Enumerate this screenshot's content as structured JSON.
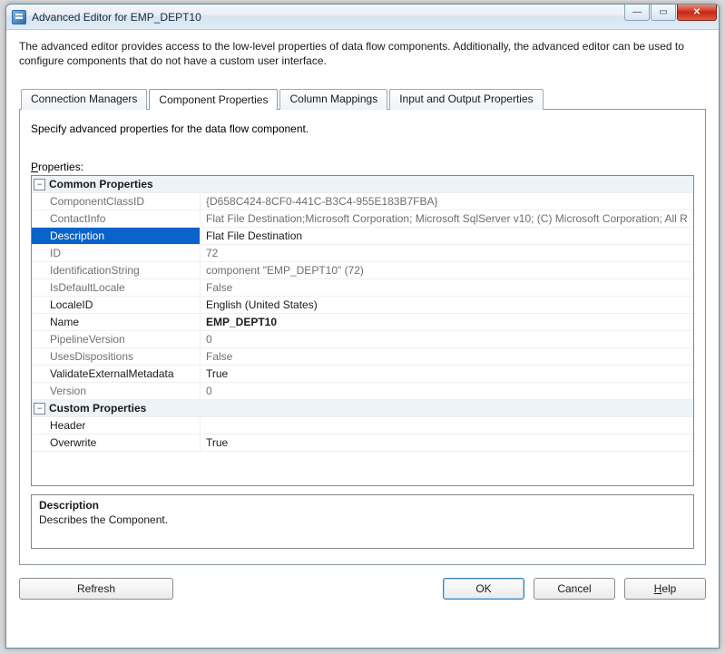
{
  "window": {
    "title": "Advanced Editor for EMP_DEPT10"
  },
  "intro": "The advanced editor provides access to the low-level properties of data flow components. Additionally, the advanced editor can be used to configure components that do not have a custom user interface.",
  "tabs": {
    "t0": "Connection Managers",
    "t1": "Component Properties",
    "t2": "Column Mappings",
    "t3": "Input and Output Properties"
  },
  "page": {
    "subhead": "Specify advanced properties for the data flow component.",
    "properties_label_rest": "roperties:"
  },
  "cats": {
    "common": "Common Properties",
    "custom": "Custom Properties"
  },
  "props": {
    "componentclassid": {
      "n": "ComponentClassID",
      "v": "{D658C424-8CF0-441C-B3C4-955E183B7FBA}"
    },
    "contactinfo": {
      "n": "ContactInfo",
      "v": "Flat File Destination;Microsoft Corporation; Microsoft SqlServer v10; (C) Microsoft Corporation; All R"
    },
    "description": {
      "n": "Description",
      "v": "Flat File Destination"
    },
    "id": {
      "n": "ID",
      "v": "72"
    },
    "identificationstring": {
      "n": "IdentificationString",
      "v": "component \"EMP_DEPT10\" (72)"
    },
    "isdefaultlocale": {
      "n": "IsDefaultLocale",
      "v": "False"
    },
    "localeid": {
      "n": "LocaleID",
      "v": "English (United States)"
    },
    "name": {
      "n": "Name",
      "v": "EMP_DEPT10"
    },
    "pipelineversion": {
      "n": "PipelineVersion",
      "v": "0"
    },
    "usesdispositions": {
      "n": "UsesDispositions",
      "v": "False"
    },
    "validateexternalmetadata": {
      "n": "ValidateExternalMetadata",
      "v": "True"
    },
    "version": {
      "n": "Version",
      "v": "0"
    },
    "header": {
      "n": "Header",
      "v": ""
    },
    "overwrite": {
      "n": "Overwrite",
      "v": "True"
    }
  },
  "desc": {
    "title": "Description",
    "body": "Describes the Component."
  },
  "buttons": {
    "refresh": "Refresh",
    "ok": "OK",
    "cancel": "Cancel",
    "help_rest": "elp"
  }
}
